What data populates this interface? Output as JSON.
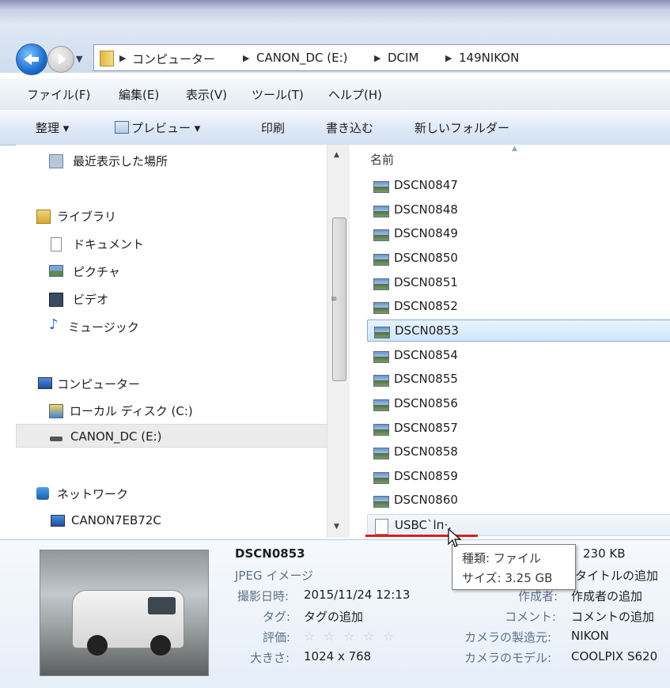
{
  "breadcrumb": [
    "コンピューター",
    "CANON_DC (E:)",
    "DCIM",
    "149NIKON"
  ],
  "menu": [
    "ファイル(F)",
    "編集(E)",
    "表示(V)",
    "ツール(T)",
    "ヘルプ(H)"
  ],
  "toolbar": {
    "organize": "整理 ▾",
    "preview": "プレビュー ▾",
    "print": "印刷",
    "burn": "書き込む",
    "new_folder": "新しいフォルダー"
  },
  "nav": {
    "recent": "最近表示した場所",
    "libraries": "ライブラリ",
    "documents": "ドキュメント",
    "pictures": "ピクチャ",
    "videos": "ビデオ",
    "music": "ミュージック",
    "computer": "コンピューター",
    "local_disk": "ローカル ディスク (C:)",
    "canon_dc": "CANON_DC (E:)",
    "network": "ネットワーク",
    "canon_host": "CANON7EB72C"
  },
  "file_list": {
    "column_name": "名前",
    "files": [
      "DSCN0847",
      "DSCN0848",
      "DSCN0849",
      "DSCN0850",
      "DSCN0851",
      "DSCN0852",
      "DSCN0853",
      "DSCN0854",
      "DSCN0855",
      "DSCN0856",
      "DSCN0857",
      "DSCN0858",
      "DSCN0859",
      "DSCN0860"
    ],
    "selected_file": "DSCN0853",
    "suspicious_file": "USBC`lп·."
  },
  "tooltip": {
    "type": "種類: ファイル",
    "size": "サイズ: 3.25 GB"
  },
  "details": {
    "filename": "DSCN0853",
    "filetype": "JPEG イメージ",
    "date_label": "撮影日時:",
    "date_value": "2015/11/24 12:13",
    "tags_label": "タグ:",
    "tags_value": "タグの追加",
    "rating_label": "評価:",
    "dimensions_label": "大きさ:",
    "dimensions_value": "1024 x 768",
    "size_value": "230 KB",
    "title_value": "タイトルの追加",
    "author_label": "作成者:",
    "author_value": "作成者の追加",
    "comment_label": "コメント:",
    "comment_value": "コメントの追加",
    "maker_label": "カメラの製造元:",
    "maker_value": "NIKON",
    "model_label": "カメラのモデル:",
    "model_value": "COOLPIX S620"
  },
  "colors": {
    "selection": "#cfe6fc",
    "selection_border": "#84acdd",
    "annotation_underline": "#e01c1c"
  }
}
